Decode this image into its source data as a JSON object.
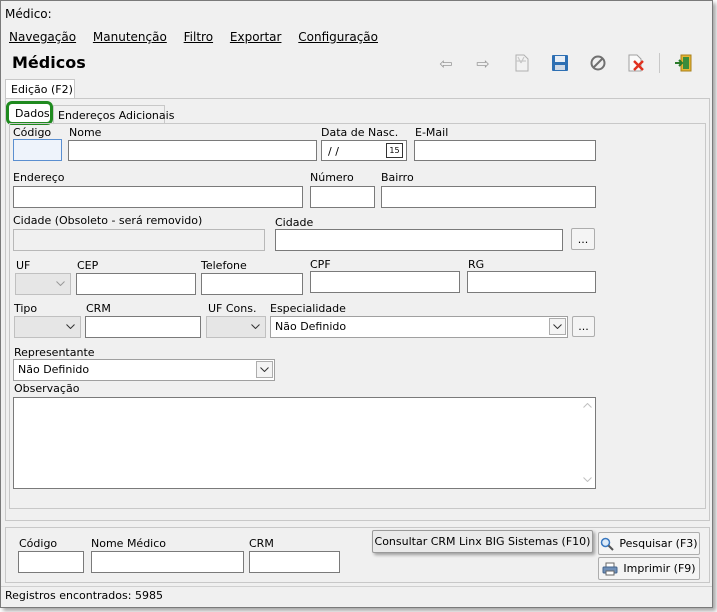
{
  "window": {
    "title": "Médico:"
  },
  "menu": [
    {
      "label": "Navegação"
    },
    {
      "label": "Manutenção"
    },
    {
      "label": "Filtro"
    },
    {
      "label": "Exportar"
    },
    {
      "label": "Configuração"
    }
  ],
  "header": {
    "title": "Médicos"
  },
  "tabs": {
    "outer": "Edição (F2)",
    "inner_active": "Dados",
    "inner_other": "Endereços Adicionais"
  },
  "form": {
    "codigo": "Código",
    "nome": "Nome",
    "data_nasc": "Data de Nasc.",
    "data_value": " /  /",
    "calendar_day": "15",
    "email": "E-Mail",
    "endereco": "Endereço",
    "numero": "Número",
    "bairro": "Bairro",
    "cidade_obs": "Cidade (Obsoleto - será removido)",
    "cidade": "Cidade",
    "ellipsis": "...",
    "uf": "UF",
    "cep": "CEP",
    "telefone": "Telefone",
    "cpf": "CPF",
    "rg": "RG",
    "tipo": "Tipo",
    "crm": "CRM",
    "uf_cons": "UF Cons.",
    "especialidade": "Especialidade",
    "especialidade_value": "Não Definido",
    "representante": "Representante",
    "representante_value": "Não Definido",
    "observacao": "Observação"
  },
  "filter": {
    "codigo": "Código",
    "nome_medico": "Nome Médico",
    "crm": "CRM",
    "consultar_button": "Consultar CRM Linx BIG Sistemas (F10)",
    "pesquisar_button": "Pesquisar (F3)",
    "imprimir_button": "Imprimir (F9)"
  },
  "status": {
    "text": "Registros encontrados: 5985"
  },
  "colors": {
    "highlight": "#1f8a1f",
    "window_bg": "#f0f0f0"
  }
}
